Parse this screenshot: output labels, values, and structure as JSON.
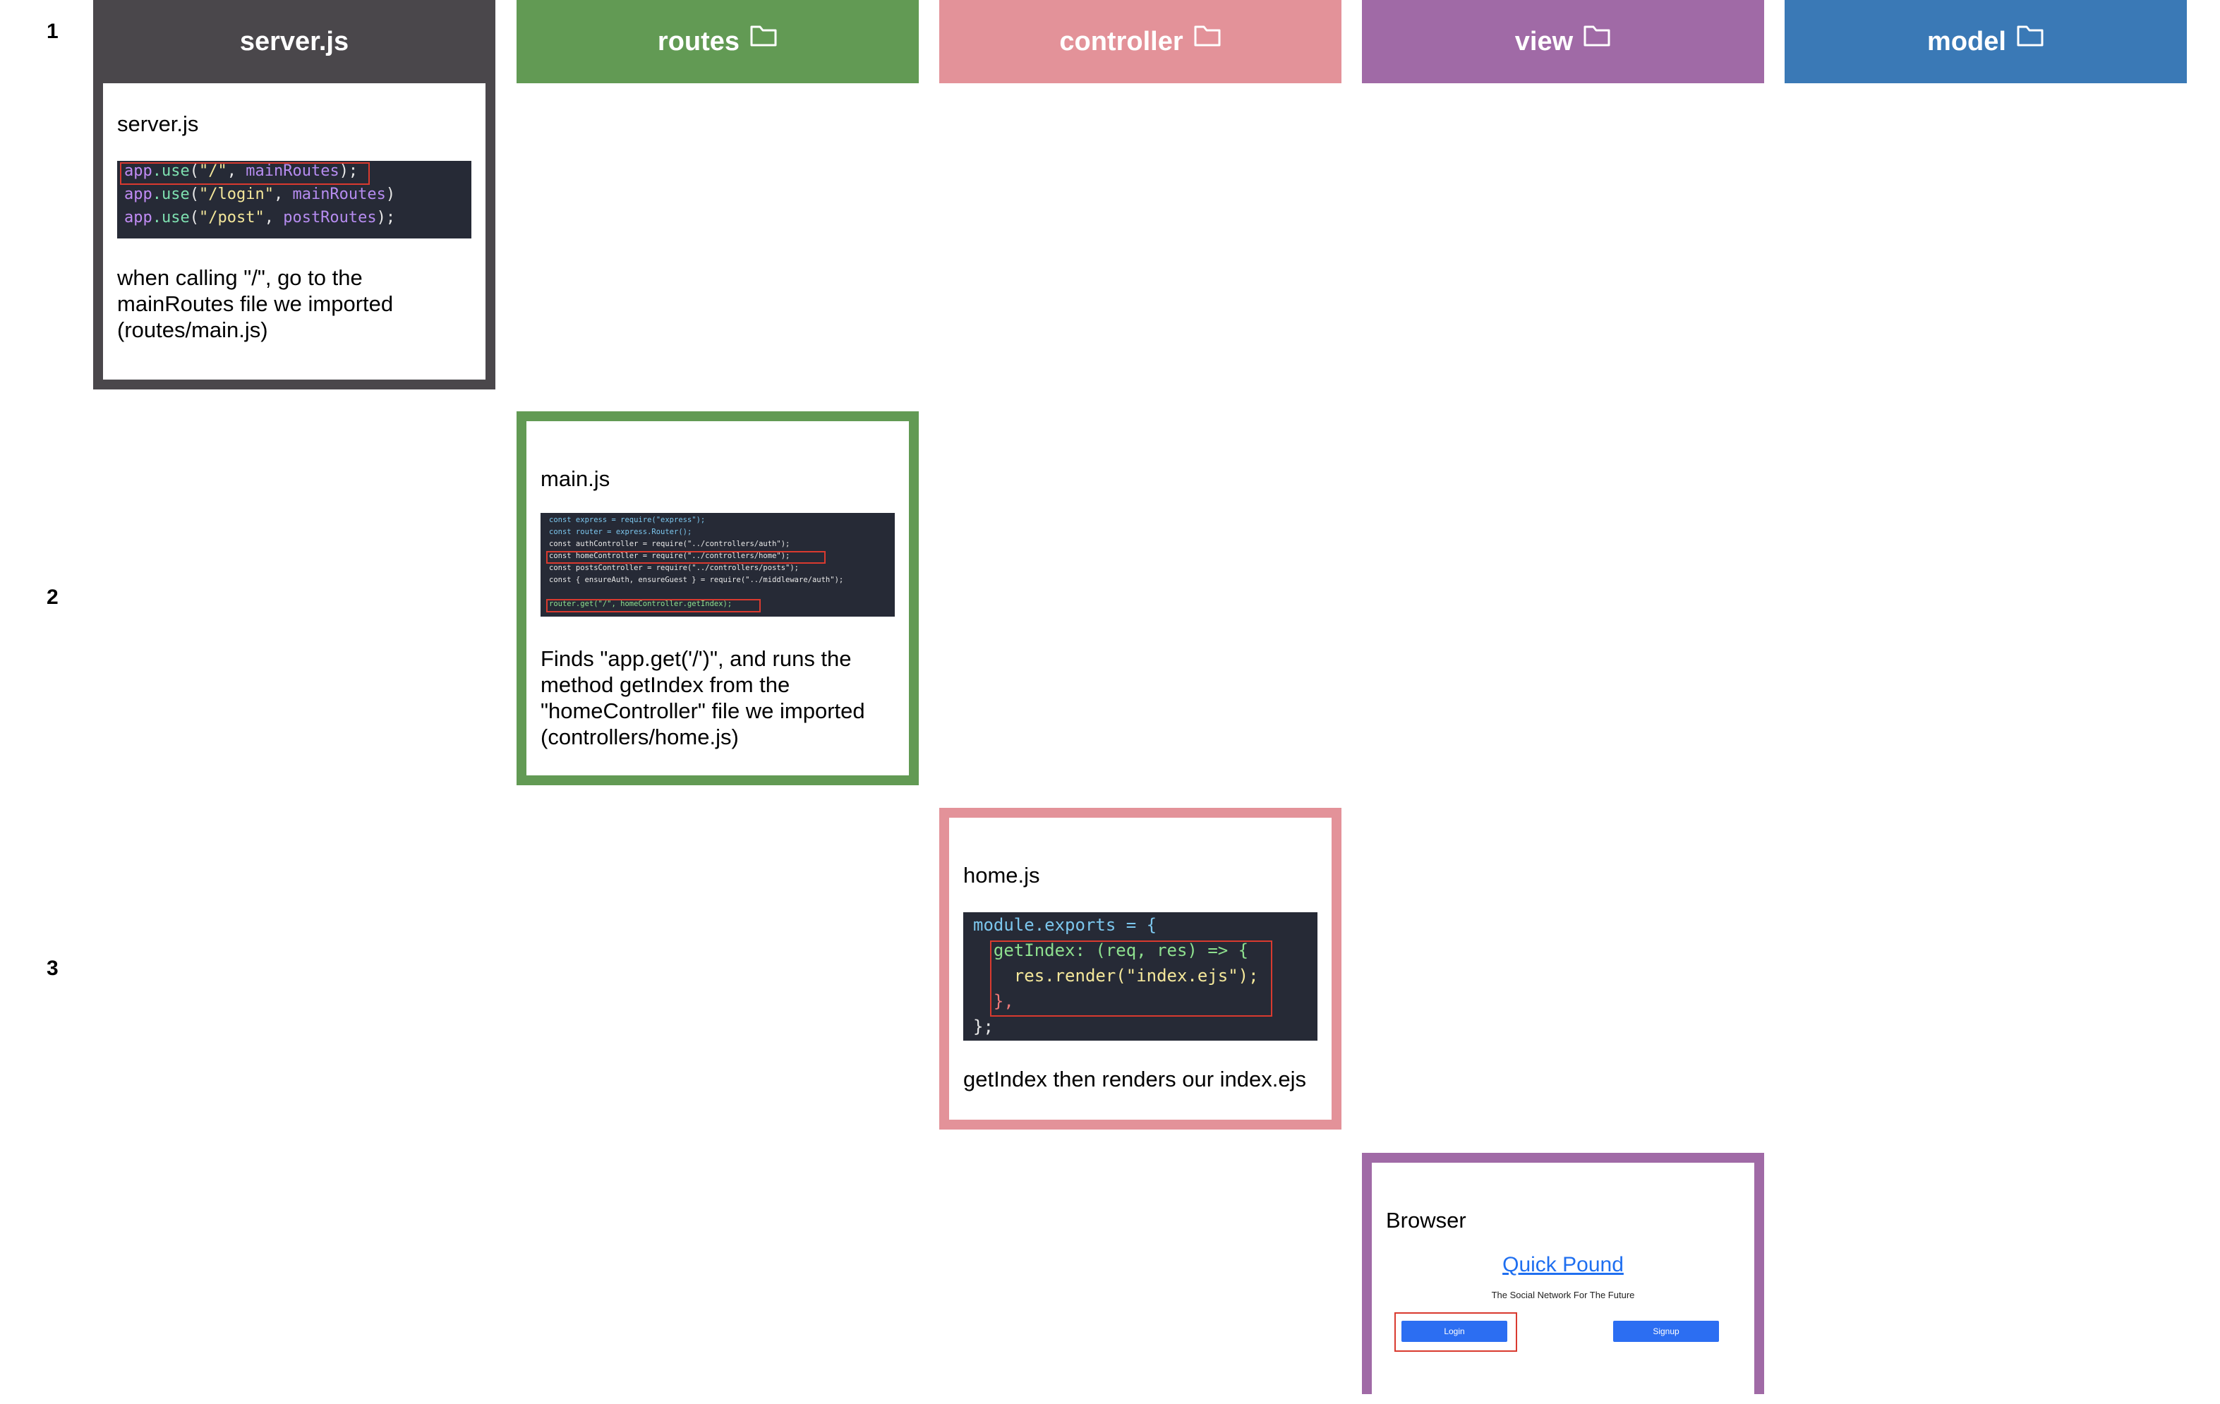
{
  "row_numbers": [
    "1",
    "2",
    "3"
  ],
  "columns": [
    {
      "label": "server.js",
      "color": "#4a474b",
      "has_folder_icon": false
    },
    {
      "label": "routes",
      "color": "#629a54",
      "has_folder_icon": true
    },
    {
      "label": "controller",
      "color": "#e39299",
      "has_folder_icon": true
    },
    {
      "label": "view",
      "color": "#a06aa6",
      "has_folder_icon": true
    },
    {
      "label": "model",
      "color": "#3a79b6",
      "has_folder_icon": true
    }
  ],
  "cards": {
    "server": {
      "title": "server.js",
      "code": [
        [
          "app",
          ".use",
          "(",
          "\"/\"",
          ", ",
          "mainRoutes",
          ");"
        ],
        [
          "app",
          ".use",
          "(",
          "\"/login\"",
          ", ",
          "mainRoutes",
          ")"
        ],
        [
          "app",
          ".use",
          "(",
          "\"/post\"",
          ", ",
          "postRoutes",
          ");"
        ]
      ],
      "description": "when calling \"/\", go to the mainRoutes file we imported (routes/main.js)"
    },
    "routes": {
      "title": "main.js",
      "code": [
        "const express = require(\"express\");",
        "const router = express.Router();",
        "const authController = require(\"../controllers/auth\");",
        "const homeController = require(\"../controllers/home\");",
        "const postsController = require(\"../controllers/posts\");",
        "const { ensureAuth, ensureGuest } = require(\"../middleware/auth\");",
        "",
        "router.get(\"/\", homeController.getIndex);"
      ],
      "description": "Finds \"app.get('/')\", and runs the method getIndex from the \"homeController\" file we imported (controllers/home.js)"
    },
    "controller": {
      "title": "home.js",
      "code": [
        "module.exports = {",
        "  getIndex: (req, res) => {",
        "    res.render(\"index.ejs\");",
        "  },",
        "};"
      ],
      "description": "getIndex then renders our index.ejs"
    },
    "view": {
      "title": "Browser",
      "site_name": "Quick Pound",
      "tagline": "The Social Network For The Future",
      "login_label": "Login",
      "signup_label": "Signup"
    }
  }
}
